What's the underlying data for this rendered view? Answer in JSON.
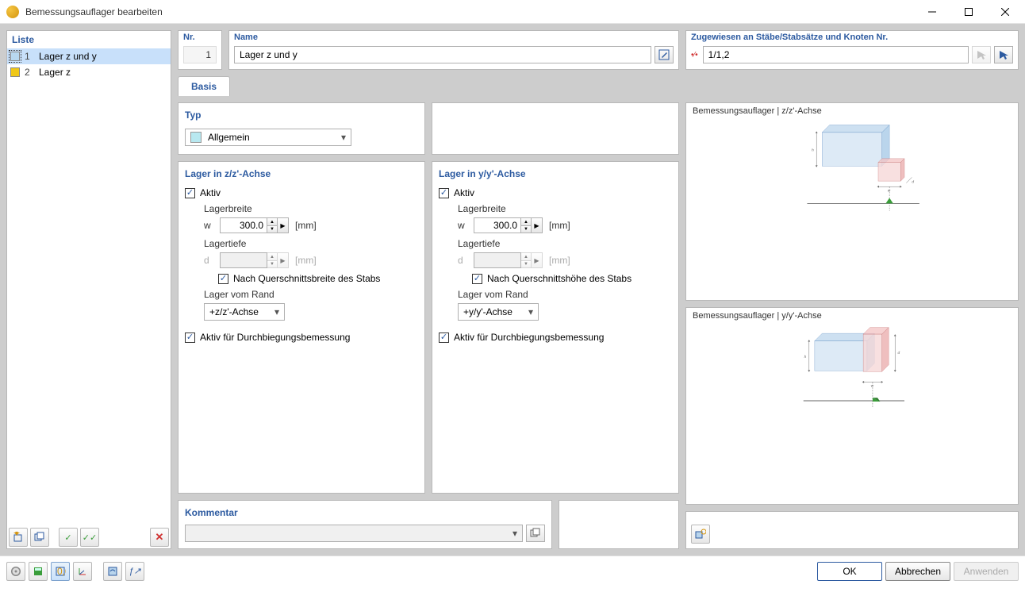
{
  "window": {
    "title": "Bemessungsauflager bearbeiten"
  },
  "list": {
    "title": "Liste",
    "items": [
      {
        "num": "1",
        "label": "Lager z und y",
        "color": "blue",
        "selected": true
      },
      {
        "num": "2",
        "label": "Lager z",
        "color": "yellow",
        "selected": false
      }
    ]
  },
  "header": {
    "nr_label": "Nr.",
    "nr_value": "1",
    "name_label": "Name",
    "name_value": "Lager z und y",
    "assign_label": "Zugewiesen an Stäbe/Stabsätze und Knoten Nr.",
    "assign_value": "1/1,2"
  },
  "tabs": {
    "basis": "Basis"
  },
  "type": {
    "title": "Typ",
    "value": "Allgemein"
  },
  "lager_z": {
    "title": "Lager in z/z'-Achse",
    "aktiv": "Aktiv",
    "lagerbreite": "Lagerbreite",
    "w": "w",
    "w_value": "300.0",
    "mm": "[mm]",
    "lagertiefe": "Lagertiefe",
    "d": "d",
    "nach_breite": "Nach Querschnittsbreite des Stabs",
    "rand": "Lager vom Rand",
    "rand_value": "+z/z'-Achse",
    "durchbieg": "Aktiv für Durchbiegungsbemessung"
  },
  "lager_y": {
    "title": "Lager in y/y'-Achse",
    "aktiv": "Aktiv",
    "lagerbreite": "Lagerbreite",
    "w": "w",
    "w_value": "300.0",
    "mm": "[mm]",
    "lagertiefe": "Lagertiefe",
    "d": "d",
    "nach_hoehe": "Nach Querschnittshöhe des Stabs",
    "rand": "Lager vom Rand",
    "rand_value": "+y/y'-Achse",
    "durchbieg": "Aktiv für Durchbiegungsbemessung"
  },
  "preview": {
    "z_title": "Bemessungsauflager | z/z'-Achse",
    "y_title": "Bemessungsauflager | y/y'-Achse",
    "h": "h",
    "w": "w",
    "d": "d"
  },
  "comment": {
    "title": "Kommentar"
  },
  "buttons": {
    "ok": "OK",
    "cancel": "Abbrechen",
    "apply": "Anwenden"
  }
}
